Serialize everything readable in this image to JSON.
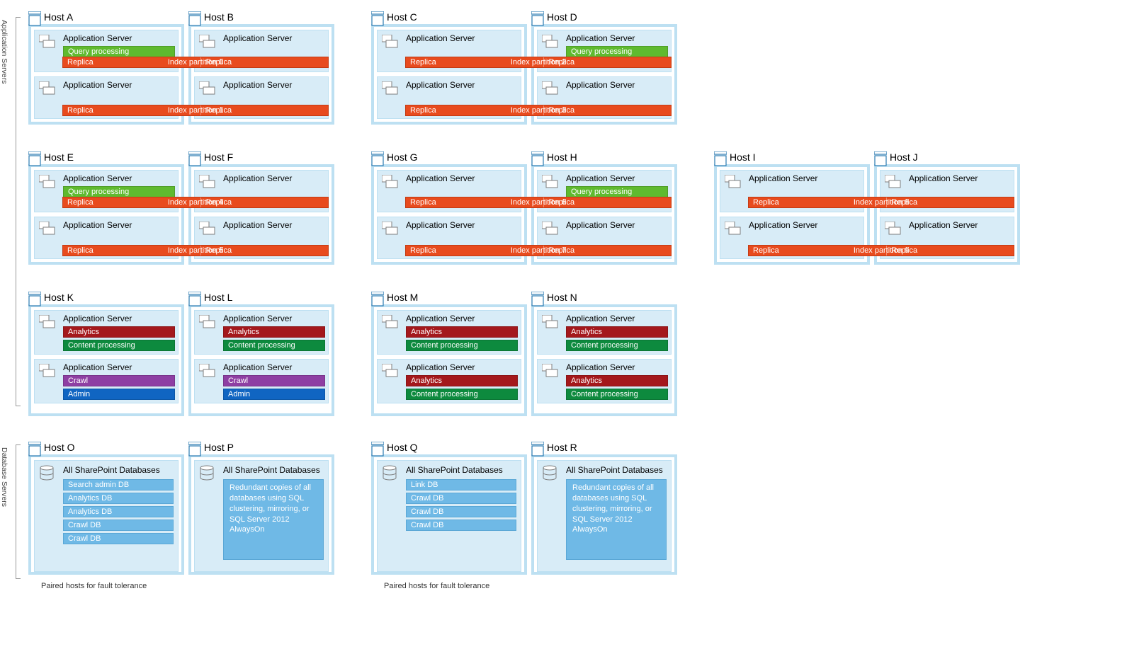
{
  "rowLabels": {
    "app": "Application Servers",
    "db": "Database Servers"
  },
  "labels": {
    "replica": "Replica",
    "appServer": "Application Server",
    "allDb": "All SharePoint Databases"
  },
  "roles": {
    "query": "Query processing",
    "analytics": "Analytics",
    "content": "Content processing",
    "crawl": "Crawl",
    "admin": "Admin"
  },
  "partitions": {
    "p0": "Index partition 0",
    "p1": "Index partition 1",
    "p2": "Index partition 2",
    "p3": "Index partition 3",
    "p4": "Index partition 4",
    "p5": "Index partition 5",
    "p6": "Index partition 6",
    "p7": "Index partition 7",
    "p8": "Index partition 8",
    "p9": "Index partition 9"
  },
  "hosts": {
    "A": "Host A",
    "B": "Host B",
    "C": "Host C",
    "D": "Host D",
    "E": "Host E",
    "F": "Host F",
    "G": "Host G",
    "H": "Host H",
    "I": "Host I",
    "J": "Host J",
    "K": "Host K",
    "L": "Host L",
    "M": "Host M",
    "N": "Host N",
    "O": "Host O",
    "P": "Host P",
    "Q": "Host Q",
    "R": "Host R"
  },
  "db": {
    "searchAdmin": "Search admin DB",
    "analytics": "Analytics DB",
    "crawl": "Crawl DB",
    "link": "Link DB",
    "redundant": "Redundant copies of all databases using SQL clustering, mirroring, or SQL Server 2012 AlwaysOn"
  },
  "captions": {
    "paired": "Paired hosts for fault tolerance"
  }
}
